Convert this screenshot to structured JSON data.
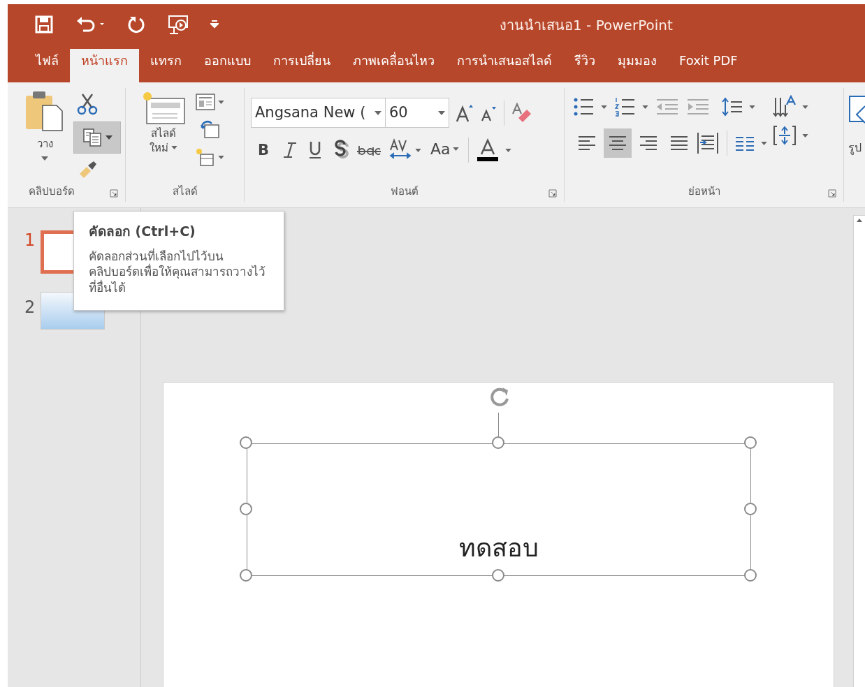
{
  "window": {
    "title": "งานนำเสนอ1 - PowerPoint"
  },
  "tabs": [
    {
      "label": "ไฟล์",
      "selected": false
    },
    {
      "label": "หน้าแรก",
      "selected": true
    },
    {
      "label": "แทรก",
      "selected": false
    },
    {
      "label": "ออกแบบ",
      "selected": false
    },
    {
      "label": "การเปลี่ยน",
      "selected": false
    },
    {
      "label": "ภาพเคลื่อนไหว",
      "selected": false
    },
    {
      "label": "การนำเสนอสไลด์",
      "selected": false
    },
    {
      "label": "รีวิว",
      "selected": false
    },
    {
      "label": "มุมมอง",
      "selected": false
    },
    {
      "label": "Foxit PDF",
      "selected": false
    }
  ],
  "ribbon": {
    "clipboard": {
      "label": "คลิปบอร์ด",
      "paste": "วาง",
      "copy_highlighted": true
    },
    "slides": {
      "label": "สไลด์",
      "new_slide": [
        "สไลด์",
        "ใหม่"
      ]
    },
    "font": {
      "label": "ฟอนต์",
      "name": "Angsana New (",
      "size": "60",
      "bold": "B",
      "change_case": "Aa"
    },
    "paragraph": {
      "label": "ย่อหน้า",
      "align": [
        {
          "selected": false
        },
        {
          "selected": true
        },
        {
          "selected": false
        },
        {
          "selected": false
        }
      ]
    },
    "cut_off_button": "รูป"
  },
  "slide_thumbnails": [
    {
      "number": "1",
      "selected": true
    },
    {
      "number": "2",
      "selected": false
    }
  ],
  "tooltip": {
    "title": "คัดลอก (Ctrl+C)",
    "text": "คัดลอกส่วนที่เลือกไปไว้บนคลิปบอร์ดเพื่อให้คุณสามารถวางไว้ที่อื่นได้"
  },
  "slide": {
    "textbox": {
      "text": "ทดสอบ",
      "selected": true
    }
  }
}
